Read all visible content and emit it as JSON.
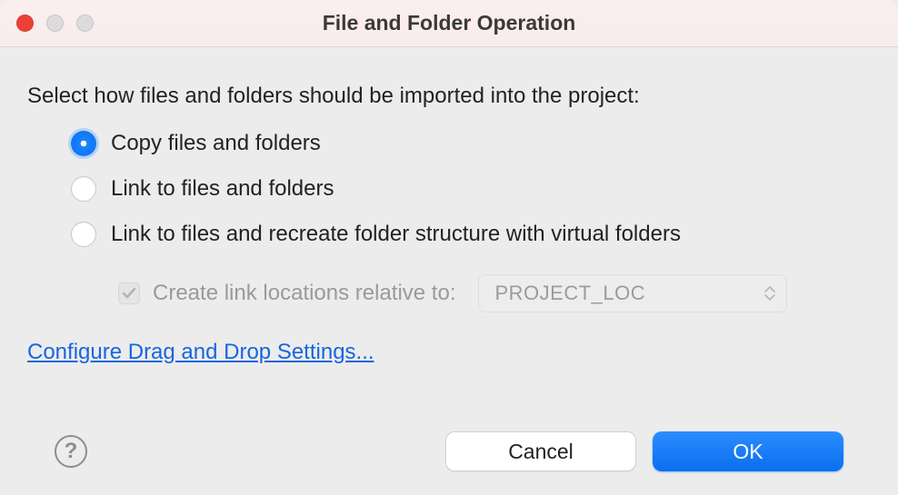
{
  "window": {
    "title": "File and Folder Operation"
  },
  "prompt": "Select how files and folders should be imported into the project:",
  "options": {
    "copy": {
      "label": "Copy files and folders",
      "selected": true
    },
    "link": {
      "label": "Link to files and folders",
      "selected": false
    },
    "virtual": {
      "label": "Link to files and recreate folder structure with virtual folders",
      "selected": false
    }
  },
  "relative": {
    "label": "Create link locations relative to:",
    "checked": true,
    "disabled": true,
    "select_value": "PROJECT_LOC"
  },
  "link_text": "Configure Drag and Drop Settings...",
  "buttons": {
    "cancel": "Cancel",
    "ok": "OK"
  }
}
